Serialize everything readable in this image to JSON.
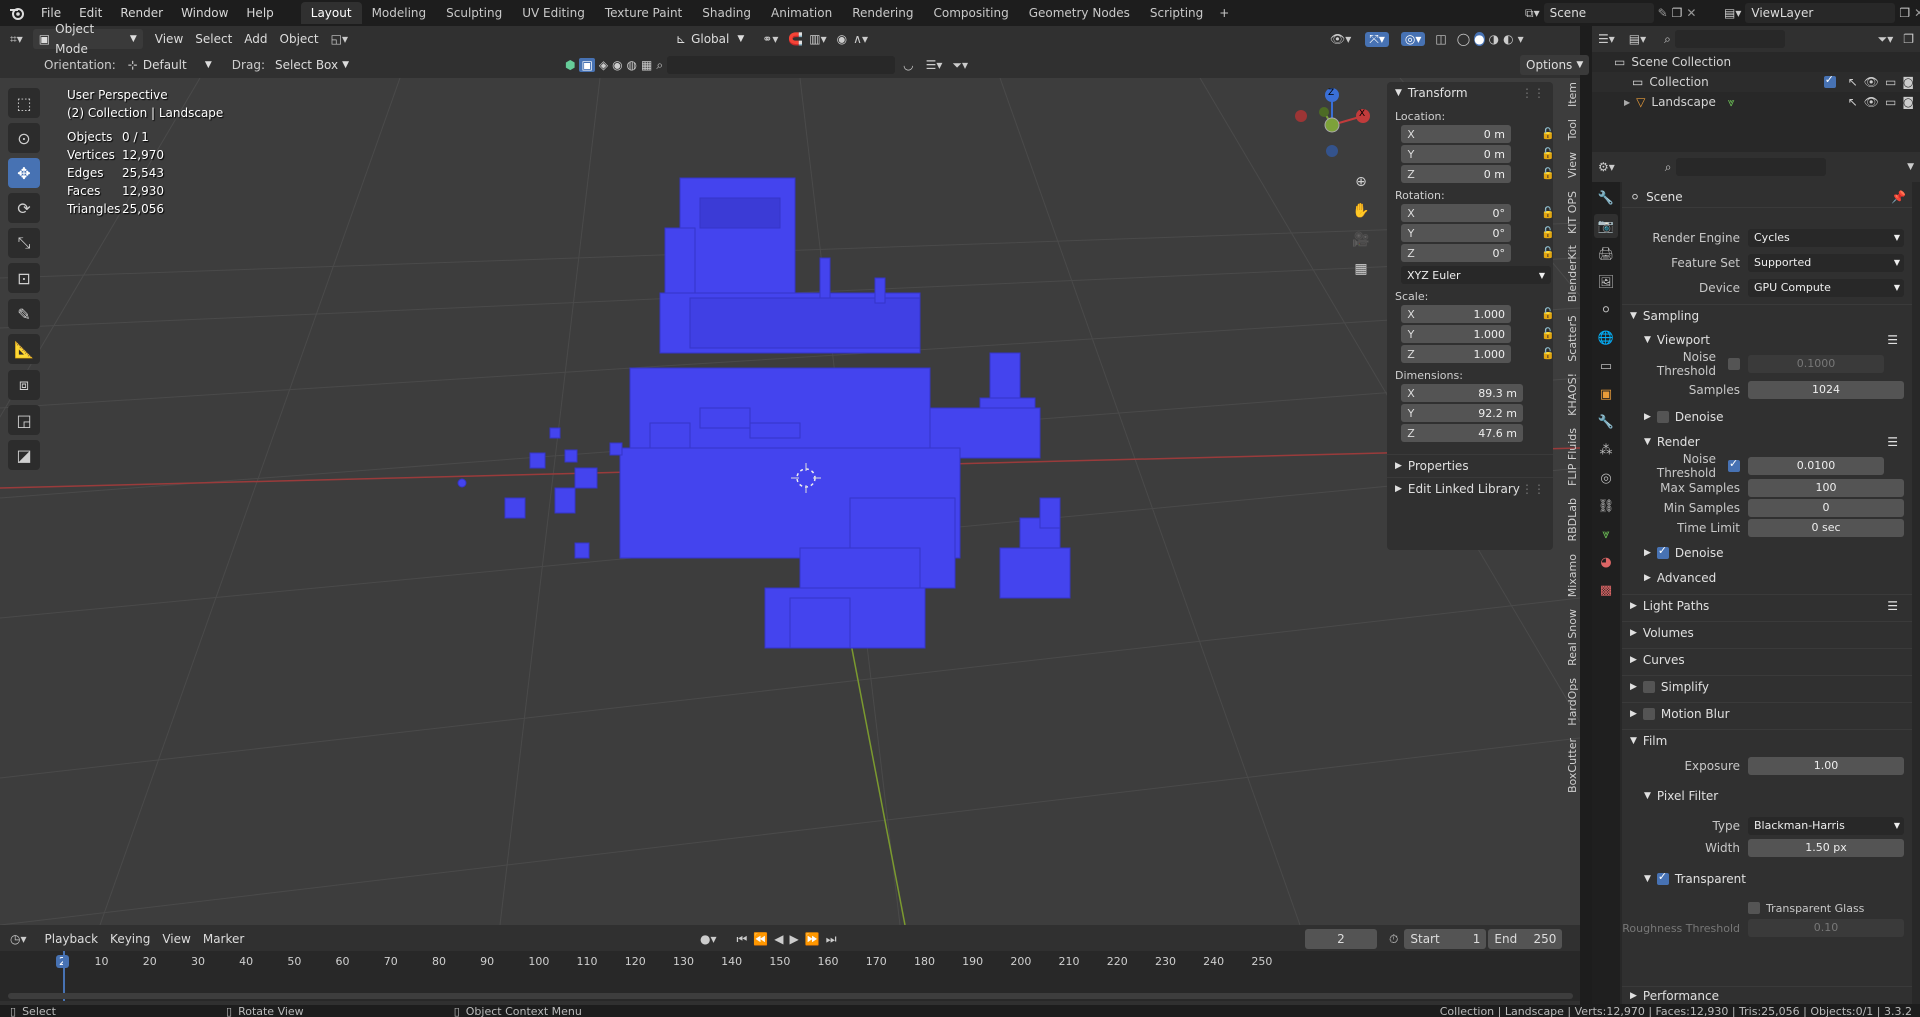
{
  "app": {
    "logo_icon": "blender-logo-icon"
  },
  "menu": [
    "File",
    "Edit",
    "Render",
    "Window",
    "Help"
  ],
  "workspaces": [
    "Layout",
    "Modeling",
    "Sculpting",
    "UV Editing",
    "Texture Paint",
    "Shading",
    "Animation",
    "Rendering",
    "Compositing",
    "Geometry Nodes",
    "Scripting"
  ],
  "active_workspace": "Layout",
  "add_workspace": "+",
  "scene_field": "Scene",
  "view_layer_field": "ViewLayer",
  "viewport_header": {
    "mode": "Object Mode",
    "menus": [
      "View",
      "Select",
      "Add",
      "Object"
    ],
    "transform_orientation": "Global",
    "orientation_label": "Orientation:",
    "orientation_value": "Default",
    "drag_label": "Drag:",
    "drag_value": "Select Box",
    "options": "Options"
  },
  "overlay": {
    "view_name": "User Perspective",
    "collection": "(2) Collection | Landscape",
    "stats": [
      {
        "label": "Objects",
        "value": "0 / 1"
      },
      {
        "label": "Vertices",
        "value": "12,970"
      },
      {
        "label": "Edges",
        "value": "25,543"
      },
      {
        "label": "Faces",
        "value": "12,930"
      },
      {
        "label": "Triangles",
        "value": "25,056"
      }
    ]
  },
  "gizmo": {
    "z": "Z",
    "x": "X"
  },
  "npanel": {
    "title": "Transform",
    "location_label": "Location:",
    "location": [
      {
        "ax": "X",
        "v": "0 m"
      },
      {
        "ax": "Y",
        "v": "0 m"
      },
      {
        "ax": "Z",
        "v": "0 m"
      }
    ],
    "rotation_label": "Rotation:",
    "rotation": [
      {
        "ax": "X",
        "v": "0°"
      },
      {
        "ax": "Y",
        "v": "0°"
      },
      {
        "ax": "Z",
        "v": "0°"
      }
    ],
    "rotation_mode": "XYZ Euler",
    "scale_label": "Scale:",
    "scale": [
      {
        "ax": "X",
        "v": "1.000"
      },
      {
        "ax": "Y",
        "v": "1.000"
      },
      {
        "ax": "Z",
        "v": "1.000"
      }
    ],
    "dimensions_label": "Dimensions:",
    "dimensions": [
      {
        "ax": "X",
        "v": "89.3 m"
      },
      {
        "ax": "Y",
        "v": "92.2 m"
      },
      {
        "ax": "Z",
        "v": "47.6 m"
      }
    ],
    "properties": "Properties",
    "edit_linked": "Edit Linked Library"
  },
  "ntabs": [
    "Item",
    "Tool",
    "View",
    "KIT OPS",
    "BlenderKit",
    "Scatter5",
    "KHAOS!",
    "FLIP Fluids",
    "RBDLab",
    "Mixamo",
    "Real Snow",
    "HardOps",
    "BoxCutter"
  ],
  "outliner": {
    "root": "Scene Collection",
    "items": [
      {
        "name": "Collection"
      },
      {
        "name": "Landscape"
      }
    ]
  },
  "properties": {
    "header": "Scene",
    "render_engine_label": "Render Engine",
    "render_engine": "Cycles",
    "feature_set_label": "Feature Set",
    "feature_set": "Supported",
    "device_label": "Device",
    "device": "GPU Compute",
    "sampling": "Sampling",
    "viewport": "Viewport",
    "noise_threshold_label": "Noise Threshold",
    "viewport_noise_threshold": "0.1000",
    "samples_label": "Samples",
    "viewport_samples": "1024",
    "denoise": "Denoise",
    "render": "Render",
    "render_noise_threshold": "0.0100",
    "max_samples_label": "Max Samples",
    "max_samples": "100",
    "min_samples_label": "Min Samples",
    "min_samples": "0",
    "time_limit_label": "Time Limit",
    "time_limit": "0 sec",
    "advanced": "Advanced",
    "light_paths": "Light Paths",
    "volumes": "Volumes",
    "curves": "Curves",
    "simplify": "Simplify",
    "motion_blur": "Motion Blur",
    "film": "Film",
    "exposure_label": "Exposure",
    "exposure": "1.00",
    "pixel_filter": "Pixel Filter",
    "type_label": "Type",
    "type": "Blackman-Harris",
    "width_label": "Width",
    "width": "1.50 px",
    "transparent": "Transparent",
    "transparent_glass": "Transparent Glass",
    "roughness_label": "Roughness Threshold",
    "roughness": "0.10",
    "performance": "Performance"
  },
  "timeline": {
    "menus": [
      "Playback",
      "Keying",
      "View",
      "Marker"
    ],
    "current_frame": "2",
    "start_label": "Start",
    "start": "1",
    "end_label": "End",
    "end": "250",
    "ticks": [
      "2",
      "10",
      "20",
      "30",
      "40",
      "50",
      "60",
      "70",
      "80",
      "90",
      "100",
      "110",
      "120",
      "130",
      "140",
      "150",
      "160",
      "170",
      "180",
      "190",
      "200",
      "210",
      "220",
      "230",
      "240",
      "250"
    ]
  },
  "status": {
    "select": "Select",
    "rotate": "Rotate View",
    "context": "Object Context Menu",
    "info": "Collection | Landscape | Verts:12,970 | Faces:12,930 | Tris:25,056 | Objects:0/1 | 3.3.2"
  },
  "colors": {
    "accent": "#4772b3",
    "mesh": "#4444ee",
    "x_axis": "#c13b3b",
    "y_axis": "#7da23a",
    "z_axis": "#3a6fd6"
  }
}
